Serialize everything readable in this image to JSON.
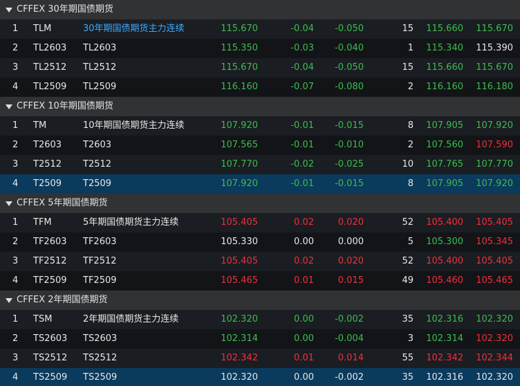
{
  "colors": {
    "up": "#f0303a",
    "down": "#3dbd4e",
    "flat": "#e8e8e8",
    "link": "#3ea8ff",
    "selected_row": "#0a3a5c"
  },
  "groups": [
    {
      "title": "CFFEX 30年期国债期货",
      "rows": [
        {
          "idx": "1",
          "code": "TLM",
          "name": "30年期国债期货主力连续",
          "last": "115.670",
          "chg": "-0.04",
          "pct": "-0.050",
          "vol": "15",
          "bid": "115.660",
          "ask": "115.670",
          "name_color": "blue",
          "last_color": "green",
          "chg_color": "green",
          "bid_color": "green",
          "ask_color": "green"
        },
        {
          "idx": "2",
          "code": "TL2603",
          "name": "TL2603",
          "last": "115.350",
          "chg": "-0.03",
          "pct": "-0.040",
          "vol": "1",
          "bid": "115.340",
          "ask": "115.390",
          "name_color": "white",
          "last_color": "green",
          "chg_color": "green",
          "bid_color": "green",
          "ask_color": "white"
        },
        {
          "idx": "3",
          "code": "TL2512",
          "name": "TL2512",
          "last": "115.670",
          "chg": "-0.04",
          "pct": "-0.050",
          "vol": "15",
          "bid": "115.660",
          "ask": "115.670",
          "name_color": "white",
          "last_color": "green",
          "chg_color": "green",
          "bid_color": "green",
          "ask_color": "green"
        },
        {
          "idx": "4",
          "code": "TL2509",
          "name": "TL2509",
          "last": "116.160",
          "chg": "-0.07",
          "pct": "-0.080",
          "vol": "2",
          "bid": "116.160",
          "ask": "116.180",
          "name_color": "white",
          "last_color": "green",
          "chg_color": "green",
          "bid_color": "green",
          "ask_color": "green"
        }
      ]
    },
    {
      "title": "CFFEX 10年期国债期货",
      "rows": [
        {
          "idx": "1",
          "code": "TM",
          "name": "10年期国债期货主力连续",
          "last": "107.920",
          "chg": "-0.01",
          "pct": "-0.015",
          "vol": "8",
          "bid": "107.905",
          "ask": "107.920",
          "name_color": "white",
          "last_color": "green",
          "chg_color": "green",
          "bid_color": "green",
          "ask_color": "green"
        },
        {
          "idx": "2",
          "code": "T2603",
          "name": "T2603",
          "last": "107.565",
          "chg": "-0.01",
          "pct": "-0.010",
          "vol": "2",
          "bid": "107.560",
          "ask": "107.590",
          "name_color": "white",
          "last_color": "green",
          "chg_color": "green",
          "bid_color": "green",
          "ask_color": "red"
        },
        {
          "idx": "3",
          "code": "T2512",
          "name": "T2512",
          "last": "107.770",
          "chg": "-0.02",
          "pct": "-0.025",
          "vol": "10",
          "bid": "107.765",
          "ask": "107.770",
          "name_color": "white",
          "last_color": "green",
          "chg_color": "green",
          "bid_color": "green",
          "ask_color": "green"
        },
        {
          "idx": "4",
          "code": "T2509",
          "name": "T2509",
          "last": "107.920",
          "chg": "-0.01",
          "pct": "-0.015",
          "vol": "8",
          "bid": "107.905",
          "ask": "107.920",
          "name_color": "white",
          "last_color": "green",
          "chg_color": "green",
          "bid_color": "green",
          "ask_color": "green",
          "selected": true
        }
      ]
    },
    {
      "title": "CFFEX 5年期国债期货",
      "rows": [
        {
          "idx": "1",
          "code": "TFM",
          "name": "5年期国债期货主力连续",
          "last": "105.405",
          "chg": "0.02",
          "pct": "0.020",
          "vol": "52",
          "bid": "105.400",
          "ask": "105.405",
          "name_color": "white",
          "last_color": "red",
          "chg_color": "red",
          "bid_color": "red",
          "ask_color": "red"
        },
        {
          "idx": "2",
          "code": "TF2603",
          "name": "TF2603",
          "last": "105.330",
          "chg": "0.00",
          "pct": "0.000",
          "vol": "5",
          "bid": "105.300",
          "ask": "105.345",
          "name_color": "white",
          "last_color": "white",
          "chg_color": "white",
          "bid_color": "green",
          "ask_color": "red"
        },
        {
          "idx": "3",
          "code": "TF2512",
          "name": "TF2512",
          "last": "105.405",
          "chg": "0.02",
          "pct": "0.020",
          "vol": "52",
          "bid": "105.400",
          "ask": "105.405",
          "name_color": "white",
          "last_color": "red",
          "chg_color": "red",
          "bid_color": "red",
          "ask_color": "red"
        },
        {
          "idx": "4",
          "code": "TF2509",
          "name": "TF2509",
          "last": "105.465",
          "chg": "0.01",
          "pct": "0.015",
          "vol": "49",
          "bid": "105.460",
          "ask": "105.465",
          "name_color": "white",
          "last_color": "red",
          "chg_color": "red",
          "bid_color": "red",
          "ask_color": "red"
        }
      ]
    },
    {
      "title": "CFFEX 2年期国债期货",
      "rows": [
        {
          "idx": "1",
          "code": "TSM",
          "name": "2年期国债期货主力连续",
          "last": "102.320",
          "chg": "0.00",
          "pct": "-0.002",
          "vol": "35",
          "bid": "102.316",
          "ask": "102.320",
          "name_color": "white",
          "last_color": "green",
          "chg_color": "green",
          "bid_color": "green",
          "ask_color": "green"
        },
        {
          "idx": "2",
          "code": "TS2603",
          "name": "TS2603",
          "last": "102.314",
          "chg": "0.00",
          "pct": "-0.004",
          "vol": "3",
          "bid": "102.314",
          "ask": "102.320",
          "name_color": "white",
          "last_color": "green",
          "chg_color": "green",
          "bid_color": "green",
          "ask_color": "red"
        },
        {
          "idx": "3",
          "code": "TS2512",
          "name": "TS2512",
          "last": "102.342",
          "chg": "0.01",
          "pct": "0.014",
          "vol": "55",
          "bid": "102.342",
          "ask": "102.344",
          "name_color": "white",
          "last_color": "red",
          "chg_color": "red",
          "bid_color": "red",
          "ask_color": "red"
        },
        {
          "idx": "4",
          "code": "TS2509",
          "name": "TS2509",
          "last": "102.320",
          "chg": "0.00",
          "pct": "-0.002",
          "vol": "35",
          "bid": "102.316",
          "ask": "102.320",
          "name_color": "white",
          "last_color": "white",
          "chg_color": "white",
          "bid_color": "white",
          "ask_color": "white",
          "selected": true
        }
      ]
    }
  ]
}
